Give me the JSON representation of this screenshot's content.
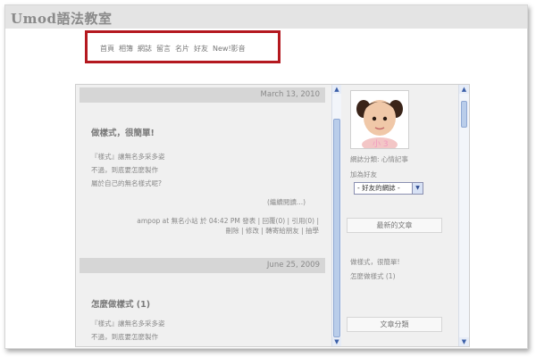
{
  "site": {
    "title": "Umod語法教室"
  },
  "nav": {
    "items": [
      "首頁",
      "相簿",
      "網誌",
      "留言",
      "名片",
      "好友",
      "New!影音"
    ]
  },
  "posts": [
    {
      "date": "March 13, 2010",
      "title": "做樣式，很簡單!",
      "lines": [
        "『樣式』讓無名多采多姿",
        "不過，到底要怎麼製作",
        "屬於自己的無名樣式呢?"
      ],
      "more": "(繼續閱讀...)",
      "meta_line1": "ampop at 無名小站 於 04:42 PM 發表 | 回覆(0) | 引用(0) |",
      "meta_line2": "刪除 | 修改 | 轉寄給朋友 | 抽學"
    },
    {
      "date": "June 25, 2009",
      "title": "怎麼做樣式 (1)",
      "lines": [
        "『樣式』讓無名多采多姿",
        "不過，到底要怎麼製作"
      ]
    }
  ],
  "sidebar": {
    "category": "網誌分類: 心情記事",
    "add_friend": "加為好友",
    "friends_select": "- 好友的網誌 -",
    "latest_heading": "最新的文章",
    "latest_links": [
      "做樣式，很簡單!",
      "怎麼做樣式 (1)"
    ],
    "category_heading": "文章分類"
  }
}
